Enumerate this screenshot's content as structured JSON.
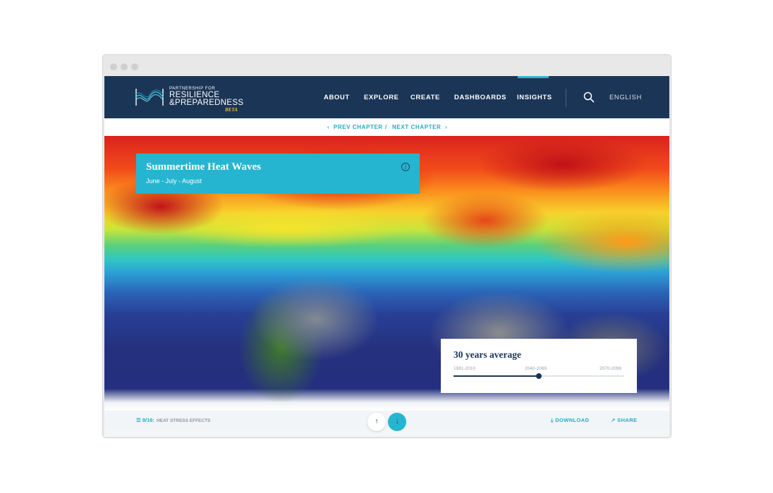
{
  "header": {
    "logo_small": "PARTNERSHIP FOR",
    "logo_line1": "RESILIENCE",
    "logo_line2": "&PREPAREDNESS",
    "logo_beta": "BETA",
    "nav": [
      {
        "label": "ABOUT"
      },
      {
        "label": "EXPLORE"
      },
      {
        "label": "CREATE"
      },
      {
        "label": "DASHBOARDS"
      },
      {
        "label": "INSIGHTS",
        "active": true
      }
    ],
    "search_icon": "search-icon",
    "language": "ENGLISH"
  },
  "chapter_nav": {
    "prev_label": "PREV CHAPTER",
    "separator": "/",
    "next_label": "NEXT CHAPTER"
  },
  "title_panel": {
    "title": "Summertime Heat Waves",
    "subtitle": "June - July - August",
    "info_icon": "i"
  },
  "average_panel": {
    "title": "30 years average",
    "ticks": [
      "1981-2010",
      "2040-2069",
      "2070-2099"
    ],
    "selected": "2040-2069",
    "selected_fraction": 0.5
  },
  "bottom_bar": {
    "progress": "9/16:",
    "section_label": "HEAT STRESS EFFECTS",
    "download_label": "DOWNLOAD",
    "share_label": "SHARE"
  },
  "buttons": {
    "up_icon": "arrow-up-icon",
    "down_icon": "arrow-down-icon"
  },
  "colors": {
    "header_bg": "#1b3556",
    "accent": "#26b5d0",
    "link": "#2aa7c7"
  }
}
